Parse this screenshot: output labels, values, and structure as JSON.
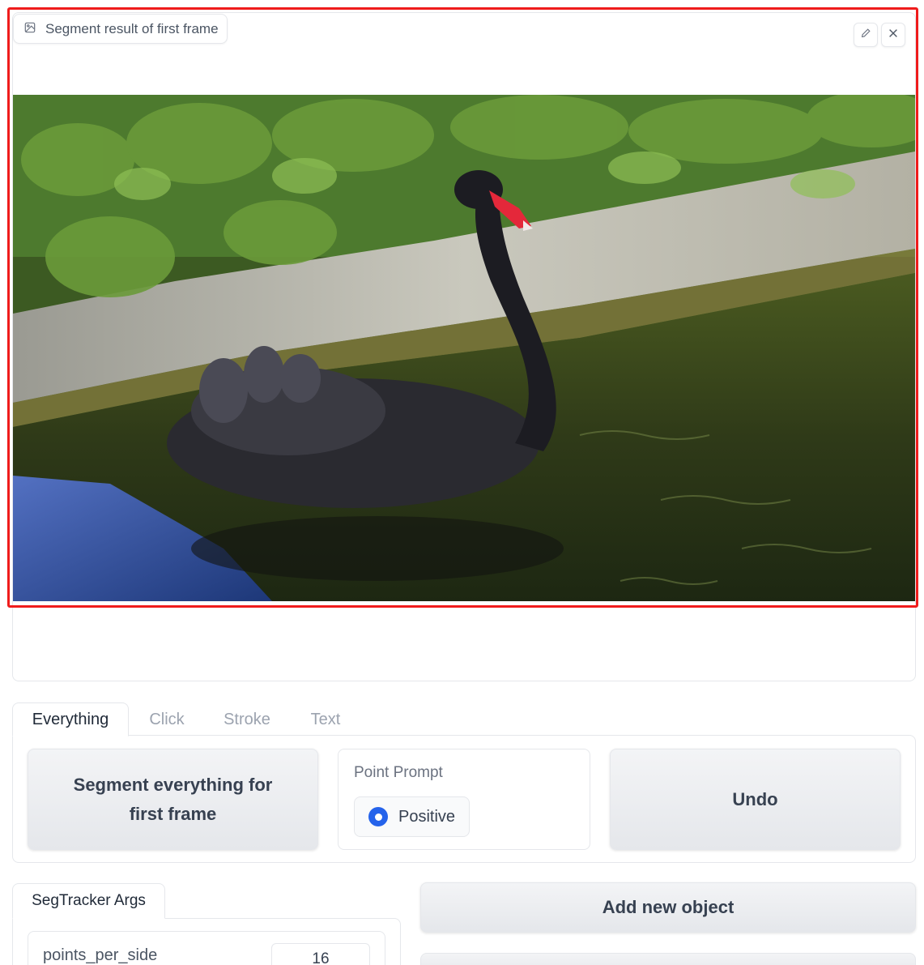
{
  "image_block": {
    "label": "Segment result of first frame",
    "label_icon": "image-icon",
    "edit_icon": "pencil-icon",
    "close_icon": "close-icon",
    "photo_subject": "black-swan-photo"
  },
  "highlight_color": "#ef1c1c",
  "tabs": [
    {
      "label": "Everything",
      "active": true
    },
    {
      "label": "Click",
      "active": false
    },
    {
      "label": "Stroke",
      "active": false
    },
    {
      "label": "Text",
      "active": false
    }
  ],
  "everything_panel": {
    "segment_button": "Segment everything for first frame",
    "point_prompt": {
      "title": "Point Prompt",
      "options": [
        {
          "label": "Positive",
          "selected": true
        }
      ]
    },
    "undo_button": "Undo"
  },
  "args": {
    "tab_label": "SegTracker Args",
    "points_per_side": {
      "label": "points_per_side",
      "value": "16"
    }
  },
  "actions": {
    "add_object_button": "Add new object"
  },
  "accent_color": "#2563eb"
}
